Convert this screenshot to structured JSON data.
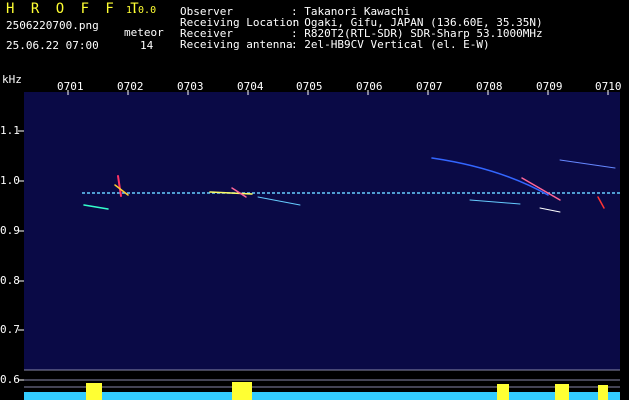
{
  "header": {
    "app_name": "H R O F F T",
    "version": "1.0.0",
    "filename": "2506220700.png",
    "datetime": "25.06.22 07:00",
    "meteor_label": "meteor",
    "meteor_count": "14",
    "fields": [
      {
        "label": "Observer",
        "value": ": Takanori Kawachi"
      },
      {
        "label": "Receiving Location",
        "value": ": Ogaki, Gifu, JAPAN (136.60E, 35.35N)"
      },
      {
        "label": "Receiver",
        "value": ": R820T2(RTL-SDR) SDR-Sharp 53.1000MHz"
      },
      {
        "label": "Receiving antenna",
        "value": ": 2el-HB9CV Vertical (el. E-W)"
      }
    ]
  },
  "axes": {
    "y_unit": "kHz",
    "y_ticks": [
      "1.1",
      "1.0",
      "0.9",
      "0.8",
      "0.7",
      "0.6"
    ],
    "x_ticks": [
      "0701",
      "0702",
      "0703",
      "0704",
      "0705",
      "0706",
      "0707",
      "0708",
      "0709",
      "0710"
    ]
  },
  "colors": {
    "background": "#000000",
    "spectrogram_bg": "#0a0a46",
    "text": "#ffffff",
    "accent": "#ffff33",
    "carrier": "#66ccff"
  }
}
